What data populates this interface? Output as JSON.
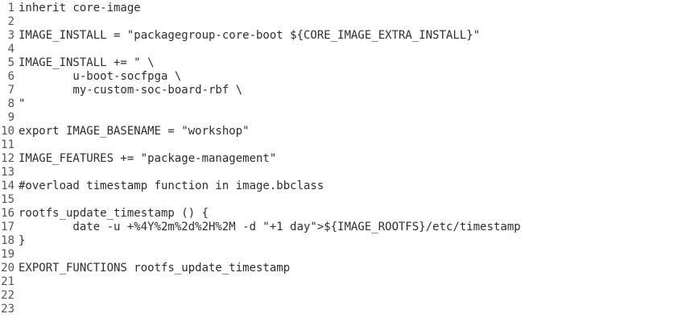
{
  "editor": {
    "lines": [
      {
        "num": "1",
        "text": "inherit core-image"
      },
      {
        "num": "2",
        "text": ""
      },
      {
        "num": "3",
        "text": "IMAGE_INSTALL = \"packagegroup-core-boot ${CORE_IMAGE_EXTRA_INSTALL}\""
      },
      {
        "num": "4",
        "text": ""
      },
      {
        "num": "5",
        "text": "IMAGE_INSTALL += \" \\"
      },
      {
        "num": "6",
        "text": "        u-boot-socfpga \\"
      },
      {
        "num": "7",
        "text": "        my-custom-soc-board-rbf \\"
      },
      {
        "num": "8",
        "text": "\""
      },
      {
        "num": "9",
        "text": ""
      },
      {
        "num": "10",
        "text": "export IMAGE_BASENAME = \"workshop\""
      },
      {
        "num": "11",
        "text": ""
      },
      {
        "num": "12",
        "text": "IMAGE_FEATURES += \"package-management\""
      },
      {
        "num": "13",
        "text": ""
      },
      {
        "num": "14",
        "text": "#overload timestamp function in image.bbclass"
      },
      {
        "num": "15",
        "text": ""
      },
      {
        "num": "16",
        "text": "rootfs_update_timestamp () {"
      },
      {
        "num": "17",
        "text": "        date -u +%4Y%2m%2d%2H%2M -d \"+1 day\">${IMAGE_ROOTFS}/etc/timestamp"
      },
      {
        "num": "18",
        "text": "}"
      },
      {
        "num": "19",
        "text": ""
      },
      {
        "num": "20",
        "text": "EXPORT_FUNCTIONS rootfs_update_timestamp"
      },
      {
        "num": "21",
        "text": ""
      },
      {
        "num": "22",
        "text": ""
      },
      {
        "num": "23",
        "text": ""
      }
    ]
  }
}
